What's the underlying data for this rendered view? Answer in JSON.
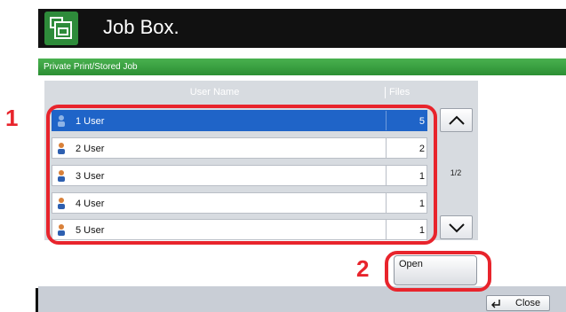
{
  "app": {
    "title": "Job Box.",
    "icon": "job-box-icon"
  },
  "window": {
    "header": "Private Print/Stored Job"
  },
  "table": {
    "headers": {
      "user_name": "User Name",
      "files": "Files"
    },
    "rows": [
      {
        "name": "1 User",
        "files": "5",
        "selected": true
      },
      {
        "name": "2 User",
        "files": "2",
        "selected": false
      },
      {
        "name": "3 User",
        "files": "1",
        "selected": false
      },
      {
        "name": "4 User",
        "files": "1",
        "selected": false
      },
      {
        "name": "5 User",
        "files": "1",
        "selected": false
      }
    ]
  },
  "pagination": {
    "indicator": "1/2"
  },
  "callouts": {
    "one": "1",
    "two": "2"
  },
  "buttons": {
    "open": "Open",
    "close": "Close"
  },
  "colors": {
    "accent_green": "#2c8f34",
    "selection_blue": "#1f64c8",
    "callout_red": "#e8242c"
  }
}
